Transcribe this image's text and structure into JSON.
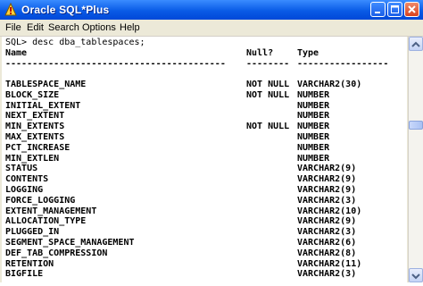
{
  "window": {
    "title": "Oracle SQL*Plus"
  },
  "menu": [
    "File",
    "Edit",
    "Search",
    "Options",
    "Help"
  ],
  "console": {
    "prompt_line": "SQL> desc dba_tablespaces;",
    "header": {
      "name": "Name",
      "null": "Null?",
      "type": "Type"
    },
    "dashes": {
      "name": "-----------------------------------------",
      "null": "--------",
      "type": "-----------------"
    },
    "rows": [
      {
        "name": "TABLESPACE_NAME",
        "null": "NOT NULL",
        "type": "VARCHAR2(30)"
      },
      {
        "name": "BLOCK_SIZE",
        "null": "NOT NULL",
        "type": "NUMBER"
      },
      {
        "name": "INITIAL_EXTENT",
        "null": "",
        "type": "NUMBER"
      },
      {
        "name": "NEXT_EXTENT",
        "null": "",
        "type": "NUMBER"
      },
      {
        "name": "MIN_EXTENTS",
        "null": "NOT NULL",
        "type": "NUMBER"
      },
      {
        "name": "MAX_EXTENTS",
        "null": "",
        "type": "NUMBER"
      },
      {
        "name": "PCT_INCREASE",
        "null": "",
        "type": "NUMBER"
      },
      {
        "name": "MIN_EXTLEN",
        "null": "",
        "type": "NUMBER"
      },
      {
        "name": "STATUS",
        "null": "",
        "type": "VARCHAR2(9)"
      },
      {
        "name": "CONTENTS",
        "null": "",
        "type": "VARCHAR2(9)"
      },
      {
        "name": "LOGGING",
        "null": "",
        "type": "VARCHAR2(9)"
      },
      {
        "name": "FORCE_LOGGING",
        "null": "",
        "type": "VARCHAR2(3)"
      },
      {
        "name": "EXTENT_MANAGEMENT",
        "null": "",
        "type": "VARCHAR2(10)"
      },
      {
        "name": "ALLOCATION_TYPE",
        "null": "",
        "type": "VARCHAR2(9)"
      },
      {
        "name": "PLUGGED_IN",
        "null": "",
        "type": "VARCHAR2(3)"
      },
      {
        "name": "SEGMENT_SPACE_MANAGEMENT",
        "null": "",
        "type": "VARCHAR2(6)"
      },
      {
        "name": "DEF_TAB_COMPRESSION",
        "null": "",
        "type": "VARCHAR2(8)"
      },
      {
        "name": "RETENTION",
        "null": "",
        "type": "VARCHAR2(11)"
      },
      {
        "name": "BIGFILE",
        "null": "",
        "type": "VARCHAR2(3)"
      }
    ]
  }
}
